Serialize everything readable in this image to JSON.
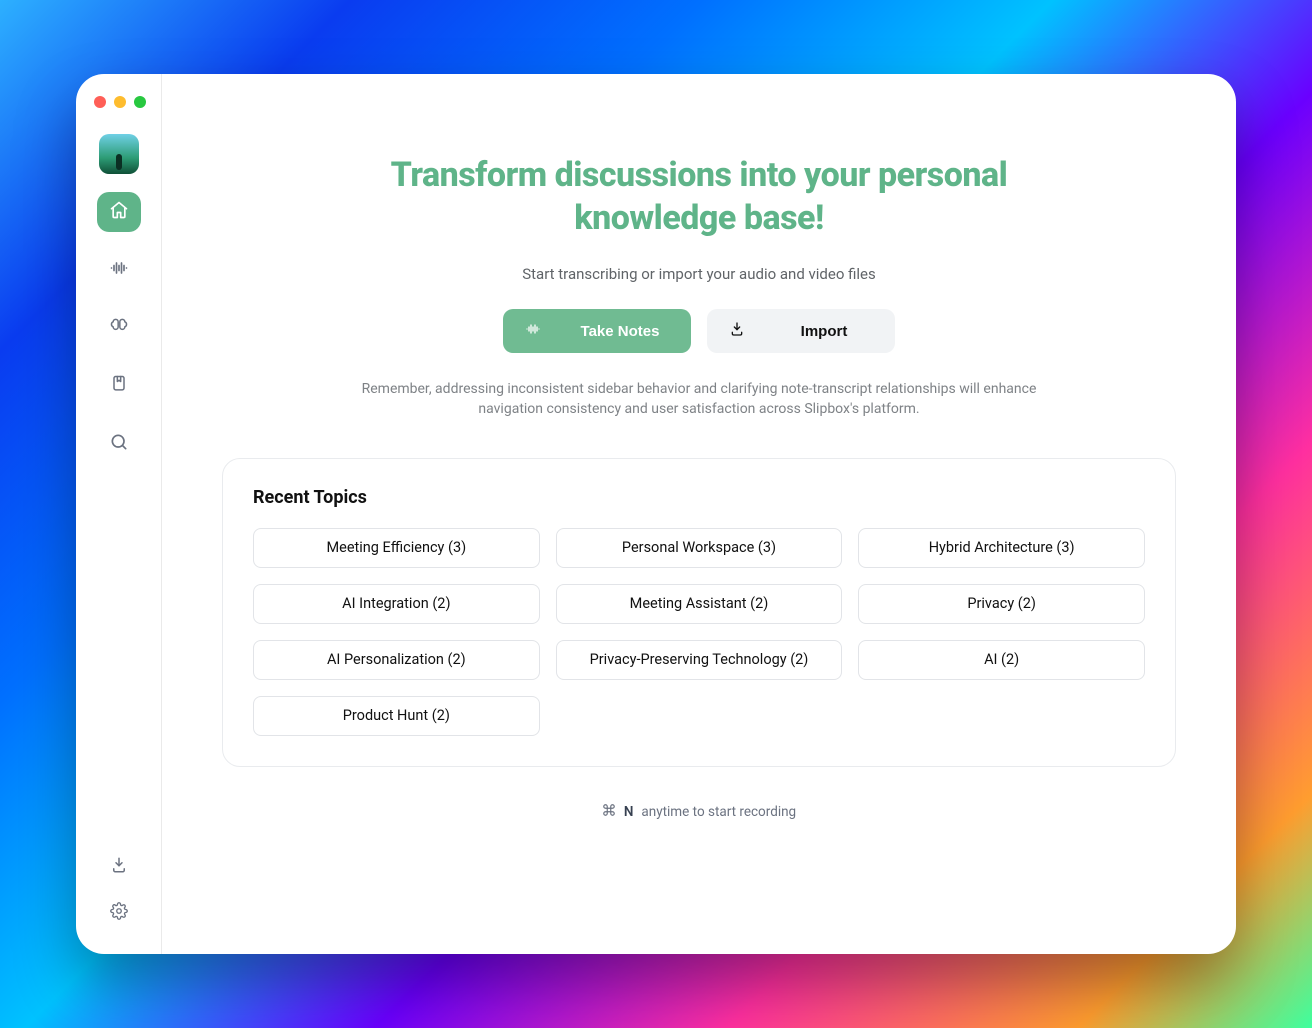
{
  "hero": {
    "headline": "Transform discussions into your personal knowledge base!",
    "subhead": "Start transcribing or import your audio and video files",
    "tip": "Remember, addressing inconsistent sidebar behavior and clarifying note-transcript relationships will enhance navigation consistency and user satisfaction across Slipbox's platform."
  },
  "actions": {
    "take_notes": "Take Notes",
    "import": "Import"
  },
  "recent": {
    "title": "Recent Topics",
    "topics": [
      {
        "label": "Meeting Efficiency (3)"
      },
      {
        "label": "Personal Workspace (3)"
      },
      {
        "label": "Hybrid Architecture (3)"
      },
      {
        "label": "AI Integration (2)"
      },
      {
        "label": "Meeting Assistant (2)"
      },
      {
        "label": "Privacy (2)"
      },
      {
        "label": "AI Personalization (2)"
      },
      {
        "label": "Privacy-Preserving Technology (2)"
      },
      {
        "label": "AI (2)"
      },
      {
        "label": "Product Hunt (2)"
      }
    ]
  },
  "shortcut": {
    "key": "N",
    "text": "anytime to start recording"
  }
}
